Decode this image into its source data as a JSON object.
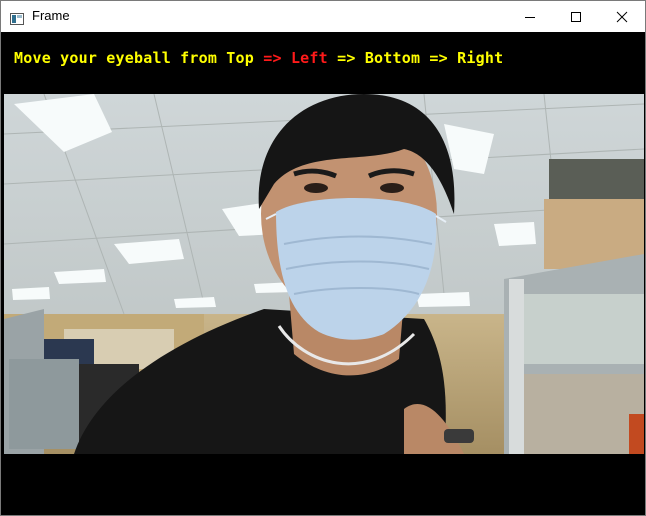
{
  "window": {
    "title": "Frame",
    "icon": "app-window-icon"
  },
  "controls": {
    "minimize": "minimize-icon",
    "maximize": "maximize-icon",
    "close": "close-icon"
  },
  "overlay": {
    "prefix": "Move your eyeball from Top",
    "arrow1": " => ",
    "step1": "Left",
    "arrow2": " => ",
    "step2": "Bottom",
    "arrow3": " => ",
    "step3": "Right",
    "colors": {
      "normal": "#ffff00",
      "highlight": "#ff1a1a"
    },
    "highlighted_step": "Left"
  },
  "video": {
    "description_icon": "webcam-feed"
  }
}
